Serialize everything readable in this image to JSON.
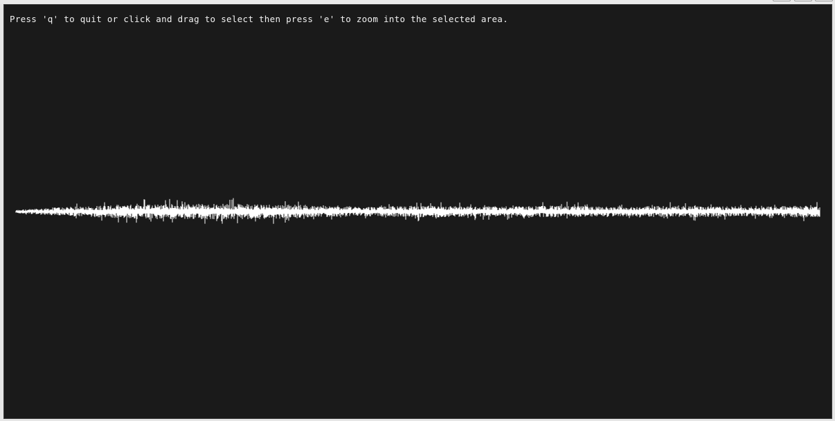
{
  "window": {
    "controls": [
      {
        "name": "minimize-button",
        "icon": "minimize-icon"
      },
      {
        "name": "maximize-button",
        "icon": "maximize-icon"
      },
      {
        "name": "close-button",
        "icon": "close-icon"
      }
    ]
  },
  "canvas": {
    "instructions": "Press 'q' to quit or click and drag to select then press 'e' to zoom into the selected area.",
    "background": "#1a1a1a",
    "waveform_color": "#ffffff"
  }
}
